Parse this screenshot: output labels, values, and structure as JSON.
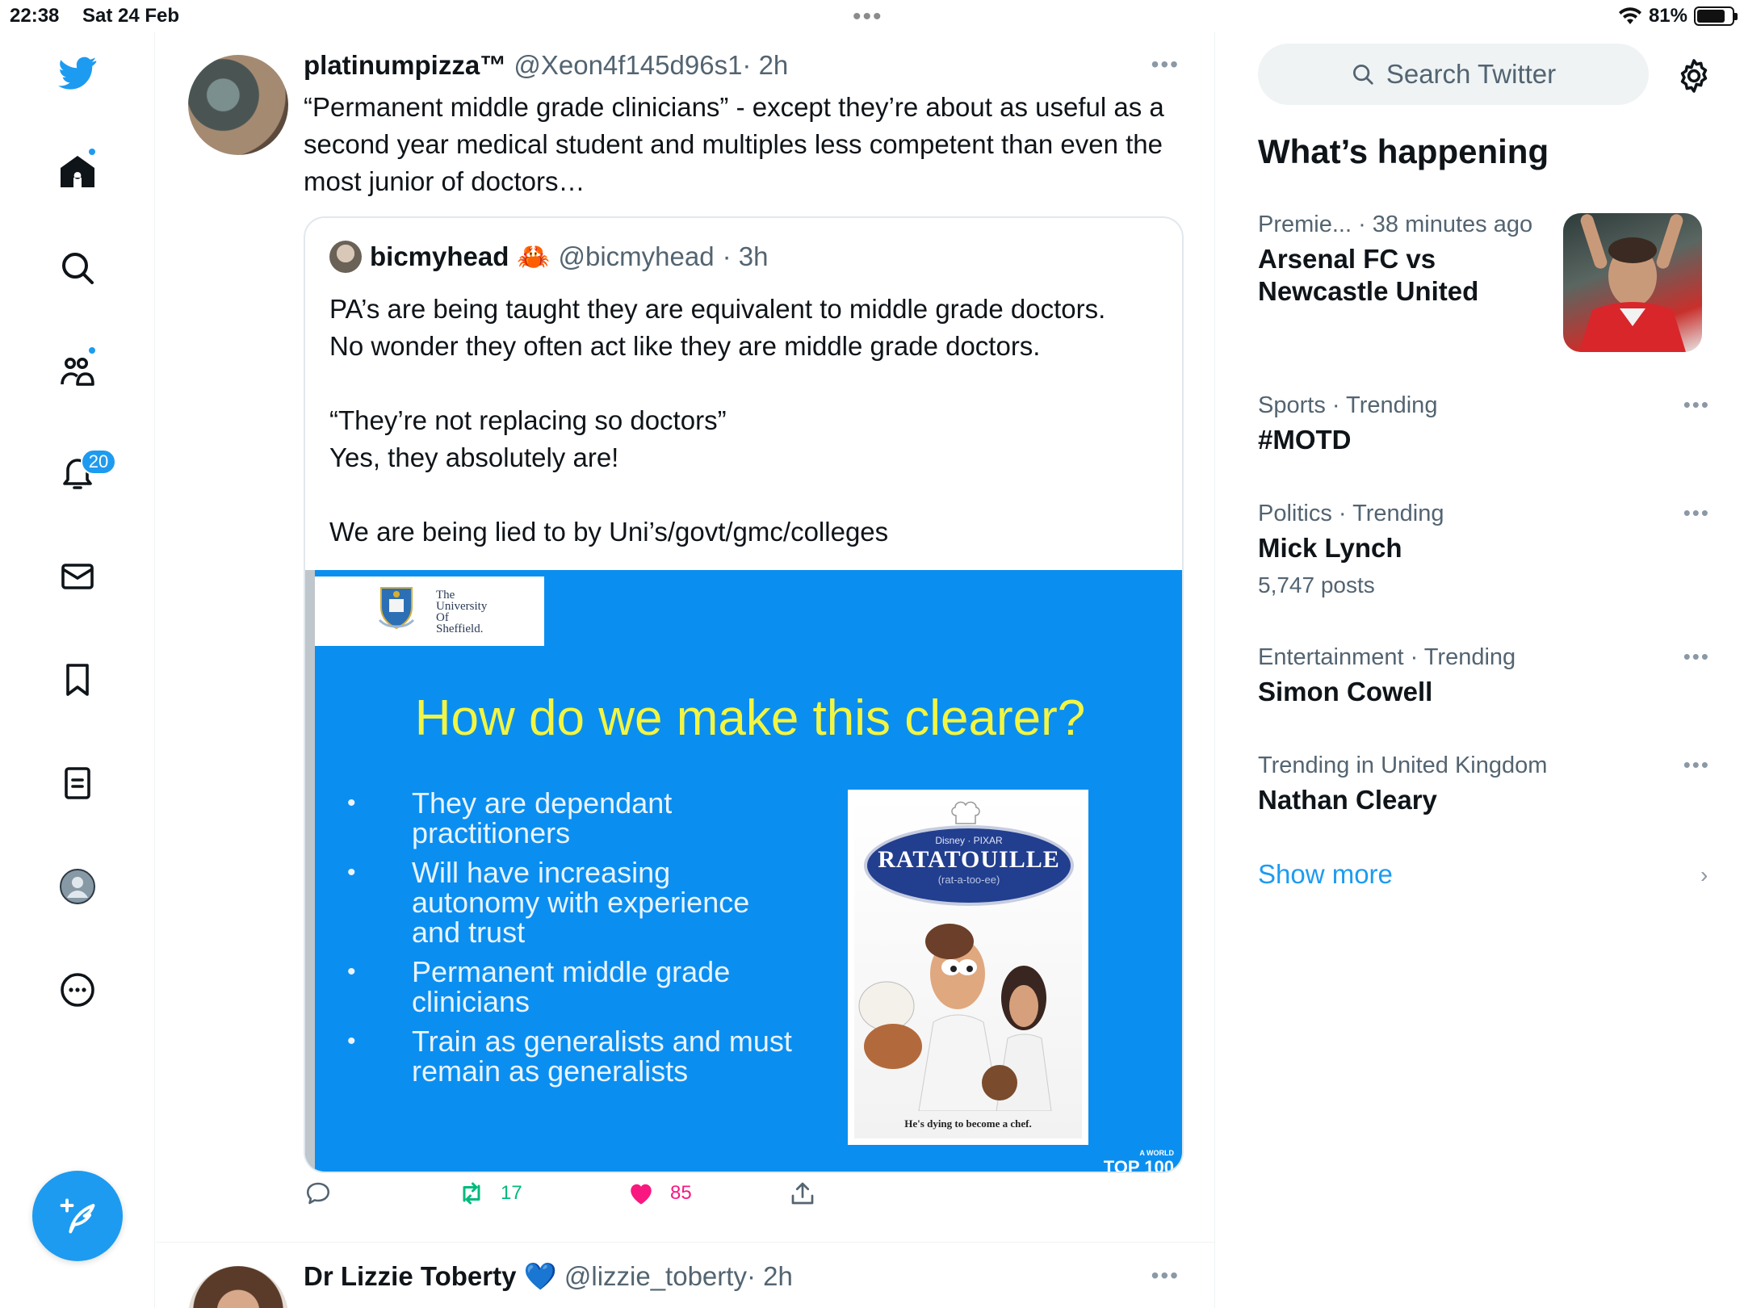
{
  "status_bar": {
    "time": "22:38",
    "date": "Sat 24 Feb",
    "battery": "81%",
    "battery_level": 0.81
  },
  "nav": {
    "items": [
      "home",
      "explore",
      "communities",
      "notifications",
      "messages",
      "bookmarks",
      "lists",
      "profile",
      "more"
    ],
    "notifications_count": "20"
  },
  "tweet1": {
    "name": "platinumpizza™",
    "handle": "@Xeon4f145d96s1",
    "time": "· 2h",
    "text": "“Permanent middle grade clinicians” - except they’re about as useful as a second year medical student and multiples less competent than even the most junior of doctors…",
    "quote": {
      "name": "bicmyhead",
      "emoji": "🦀",
      "handle": "@bicmyhead",
      "time": "· 3h",
      "lines": [
        "PA’s are being taught they are equivalent to middle grade doctors.",
        "No wonder they often act like they are middle grade doctors.",
        "",
        "“They’re not replacing so doctors”",
        "Yes, they absolutely are!",
        "",
        "We are being lied to by Uni’s/govt/gmc/colleges"
      ],
      "slide": {
        "uni_lines": [
          "The",
          "University",
          "Of",
          "Sheffield."
        ],
        "title": "How do we make this clearer?",
        "bullets": [
          "They are dependant practitioners",
          "Will have increasing autonomy with experience and trust",
          "Permanent middle grade clinicians",
          "Train as generalists and must remain as generalists"
        ],
        "poster_top": "Disney · PIXAR",
        "poster_title": "RATATOUILLE",
        "poster_pron": "(rat-a-too-ee)",
        "poster_caption": "He's dying to become a chef.",
        "corner_small": "A WORLD",
        "corner_big": "TOP 100"
      }
    },
    "actions": {
      "retweets": "17",
      "likes": "85"
    }
  },
  "tweet2": {
    "name": "Dr Lizzie Toberty",
    "emoji": "💙",
    "handle": "@lizzie_toberty",
    "time": "· 2h"
  },
  "sidebar": {
    "search_placeholder": "Search Twitter",
    "title": "What’s happening",
    "trends": [
      {
        "meta": "Premie... · 38 minutes ago",
        "topic": "Arsenal FC vs Newcastle United",
        "posts": ""
      },
      {
        "meta": "Sports · Trending",
        "topic": "#MOTD",
        "posts": ""
      },
      {
        "meta": "Politics · Trending",
        "topic": "Mick Lynch",
        "posts": "5,747 posts"
      },
      {
        "meta": "Entertainment · Trending",
        "topic": "Simon Cowell",
        "posts": ""
      },
      {
        "meta": "Trending in United Kingdom",
        "topic": "Nathan Cleary",
        "posts": ""
      }
    ],
    "show_more": "Show more"
  },
  "colors": {
    "accent": "#1d9bf0",
    "like": "#f91880",
    "retweet": "#00ba7c",
    "slide_bg": "#0a8ff0",
    "slide_title": "#f2f542"
  }
}
